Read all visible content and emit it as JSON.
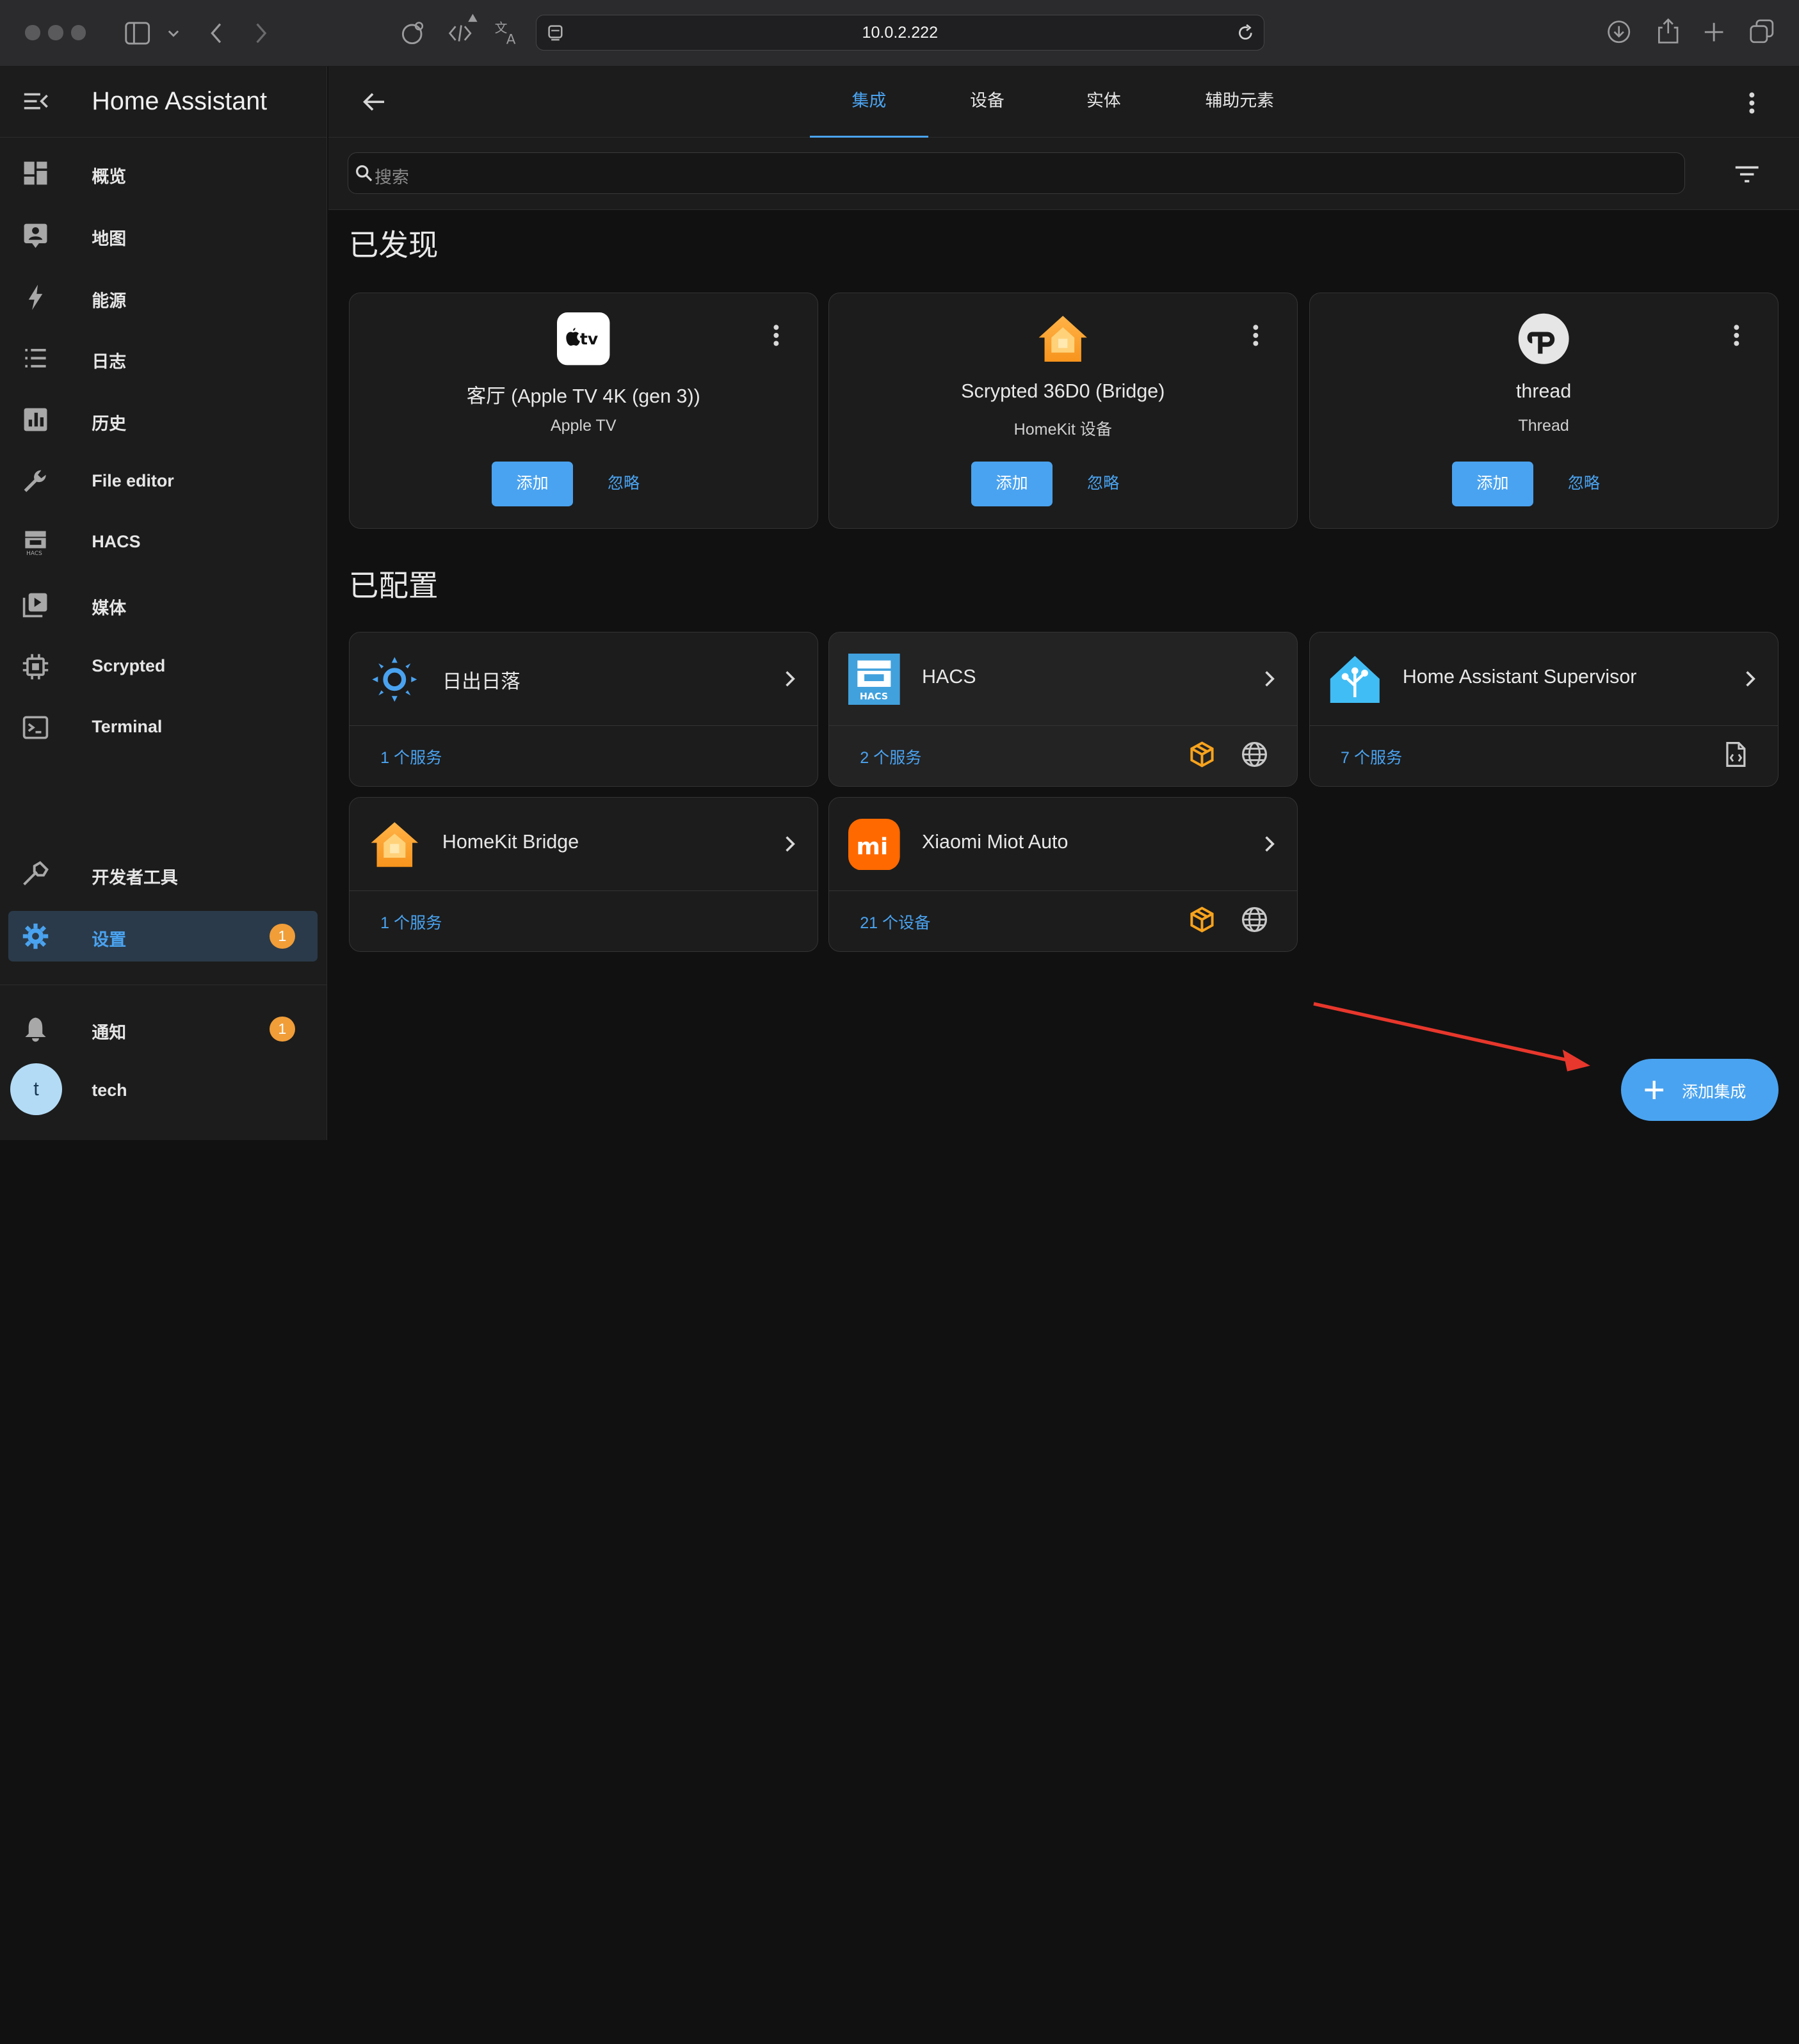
{
  "browser": {
    "url": "10.0.2.222"
  },
  "sidebar": {
    "title": "Home Assistant",
    "items": [
      {
        "label": "概览",
        "icon": "dashboard-icon"
      },
      {
        "label": "地图",
        "icon": "map-icon"
      },
      {
        "label": "能源",
        "icon": "lightning-icon"
      },
      {
        "label": "日志",
        "icon": "logbook-icon"
      },
      {
        "label": "历史",
        "icon": "history-chart-icon"
      },
      {
        "label": "File editor",
        "icon": "wrench-icon"
      },
      {
        "label": "HACS",
        "icon": "hacs-store-icon"
      },
      {
        "label": "媒体",
        "icon": "media-play-icon"
      },
      {
        "label": "Scrypted",
        "icon": "chip-icon"
      },
      {
        "label": "Terminal",
        "icon": "terminal-icon"
      }
    ],
    "dev_tools": "开发者工具",
    "settings": {
      "label": "设置",
      "badge": "1"
    },
    "notifications": {
      "label": "通知",
      "badge": "1"
    },
    "user": {
      "initial": "t",
      "name": "tech"
    }
  },
  "tabs": [
    "集成",
    "设备",
    "实体",
    "辅助元素"
  ],
  "search": {
    "placeholder": "搜索"
  },
  "discovered": {
    "title": "已发现",
    "cards": [
      {
        "name": "客厅 (Apple TV 4K (gen 3))",
        "sub": "Apple TV",
        "add": "添加",
        "ignore": "忽略",
        "logo_text": "tv"
      },
      {
        "name": "Scrypted 36D0 (Bridge)",
        "sub": "HomeKit 设备",
        "add": "添加",
        "ignore": "忽略"
      },
      {
        "name": "thread",
        "sub": "Thread",
        "add": "添加",
        "ignore": "忽略"
      }
    ]
  },
  "configured": {
    "title": "已配置",
    "cards": [
      {
        "name": "日出日落",
        "services": "1 个服务"
      },
      {
        "name": "HACS",
        "services": "2 个服务",
        "logo_text": "HACS"
      },
      {
        "name": "Home Assistant Supervisor",
        "services": "7 个服务"
      },
      {
        "name": "HomeKit Bridge",
        "services": "1 个服务"
      },
      {
        "name": "Xiaomi Miot Auto",
        "services": "21 个设备",
        "logo_text": "mi"
      }
    ]
  },
  "fab": {
    "label": "添加集成"
  },
  "colors": {
    "accent": "#4aa3f0",
    "badge": "#f19d38",
    "annotation_arrow": "#e8372c"
  }
}
